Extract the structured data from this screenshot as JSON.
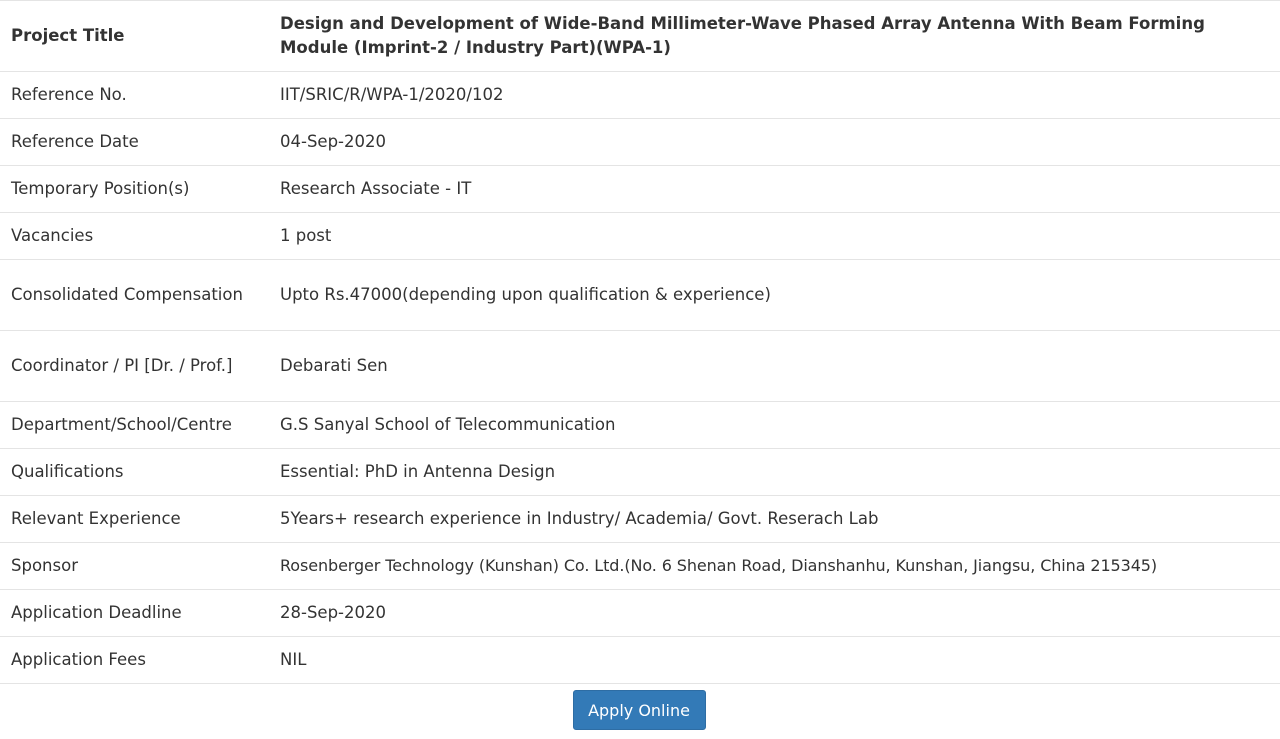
{
  "rows": [
    {
      "label": "Project Title",
      "value": "Design and Development of Wide-Band Millimeter-Wave Phased Array Antenna With Beam Forming Module (Imprint-2 / Industry Part)(WPA-1)"
    },
    {
      "label": "Reference No.",
      "value": "IIT/SRIC/R/WPA-1/2020/102"
    },
    {
      "label": "Reference Date",
      "value": "04-Sep-2020"
    },
    {
      "label": "Temporary Position(s)",
      "value": "Research Associate - IT"
    },
    {
      "label": "Vacancies",
      "value": "1 post"
    },
    {
      "label": "Consolidated Compensation",
      "value": "Upto Rs.47000(depending upon qualification & experience)"
    },
    {
      "label": "Coordinator / PI [Dr. / Prof.]",
      "value": "Debarati Sen"
    },
    {
      "label": "Department/School/Centre",
      "value": "G.S Sanyal School of Telecommunication"
    },
    {
      "label": "Qualifications",
      "value": "Essential: PhD in Antenna Design"
    },
    {
      "label": "Relevant Experience",
      "value": "5Years+ research experience in Industry/ Academia/ Govt. Reserach Lab"
    },
    {
      "label": "Sponsor",
      "value": "Rosenberger Technology (Kunshan) Co. Ltd.(No. 6 Shenan Road, Dianshanhu, Kunshan, Jiangsu, China 215345)"
    },
    {
      "label": "Application Deadline",
      "value": "28-Sep-2020"
    },
    {
      "label": "Application Fees",
      "value": "NIL"
    }
  ],
  "apply_button": {
    "label": "Apply Online"
  },
  "colors": {
    "button": "#337ab7",
    "border": "#e4e4e4",
    "text": "#333333"
  }
}
